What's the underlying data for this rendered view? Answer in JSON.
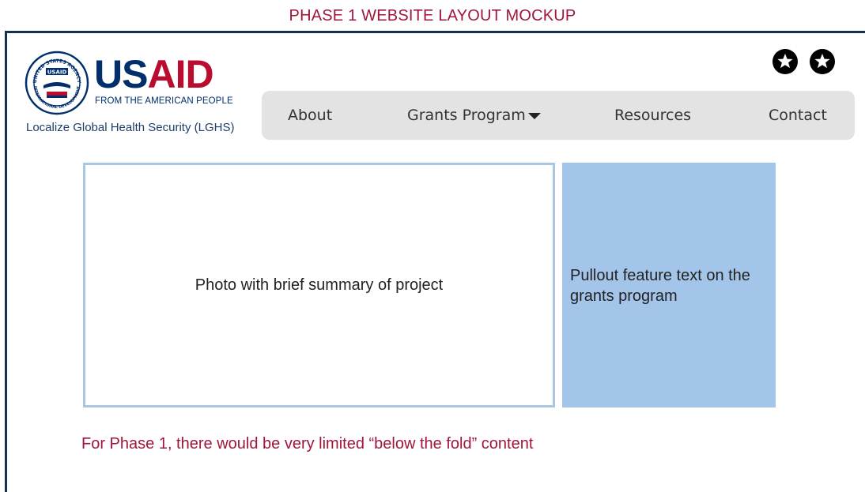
{
  "mockup_title": "PHASE 1 WEBSITE LAYOUT MOCKUP",
  "logo": {
    "wordmark_us": "US",
    "wordmark_aid": "AID",
    "tagline": "FROM THE AMERICAN PEOPLE",
    "seal_text_top": "UNITED STATES AGENCY",
    "seal_text_bottom": "INTERNATIONAL DEVELOPMENT",
    "seal_badge": "USAID"
  },
  "program_name": "Localize Global Health Security (LGHS)",
  "social_icons": [
    "star-icon",
    "star-icon"
  ],
  "nav": {
    "items": [
      {
        "label": "About",
        "has_dropdown": false
      },
      {
        "label": "Grants Program",
        "has_dropdown": true
      },
      {
        "label": "Resources",
        "has_dropdown": false
      },
      {
        "label": "Contact",
        "has_dropdown": false
      }
    ]
  },
  "hero": {
    "photo_text": "Photo with brief summary of project",
    "pullout_text": "Pullout feature text on the grants program"
  },
  "footer_note": "For Phase 1, there would be very limited “below the fold” content",
  "colors": {
    "accent_red": "#a0163a",
    "usaid_blue": "#002f6c",
    "usaid_red": "#ba0c2f",
    "frame_navy": "#12324f",
    "nav_bg": "#e3e3e3",
    "pullout_bg": "#a4c5ea",
    "photo_border": "#a9c6e2"
  }
}
